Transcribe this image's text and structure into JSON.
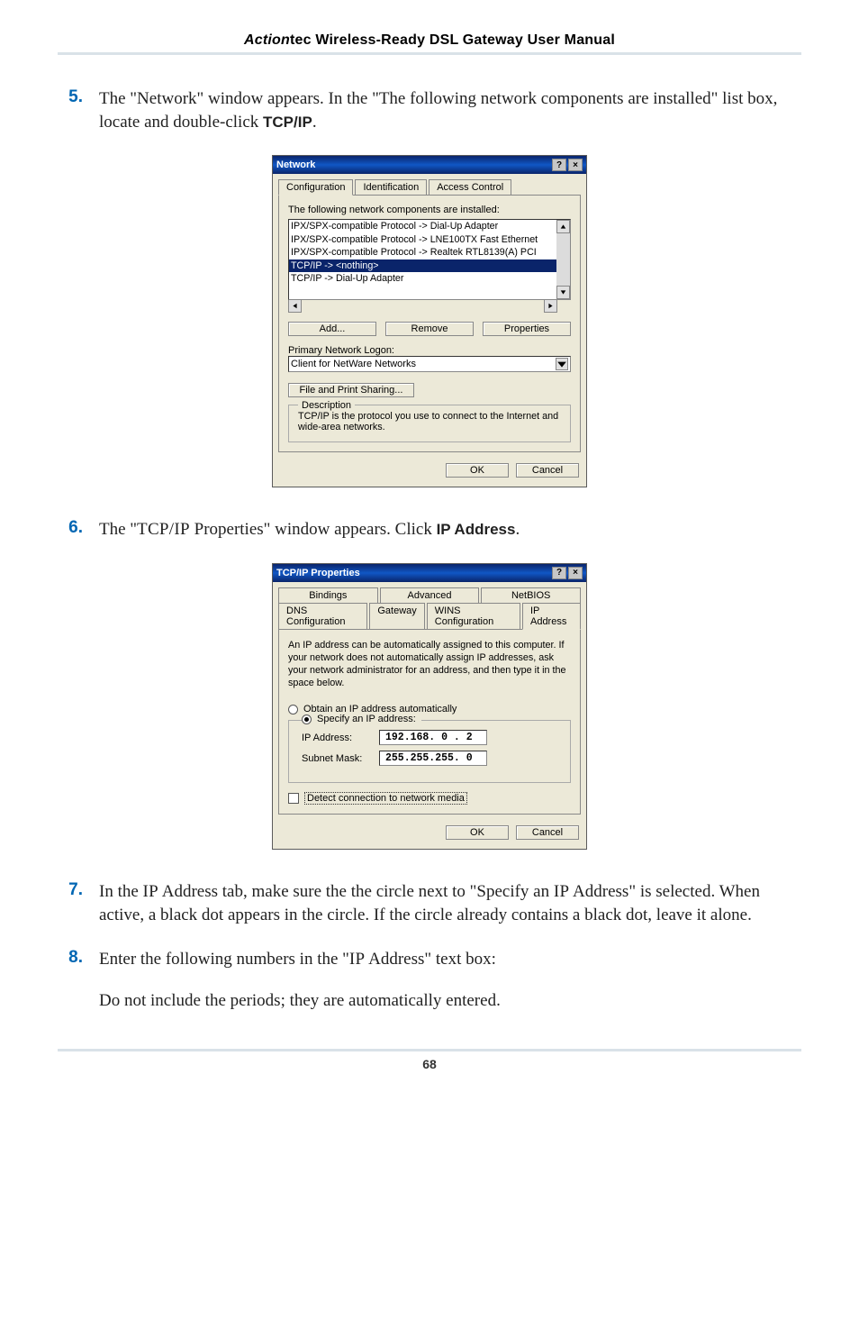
{
  "header": {
    "brand_italic": "Action",
    "brand_rest": "tec",
    "title_rest": " Wireless-Ready DSL Gateway User Manual"
  },
  "steps": {
    "s5": {
      "num": "5.",
      "text_a": "The \"Network\" window appears. In the \"The following network components are installed\" list box, locate and double-click ",
      "bold": "TCP/IP",
      "text_b": "."
    },
    "s6": {
      "num": "6.",
      "text_a": "The \"",
      "sc1": "TCP/IP",
      "text_b": " Properties\" window appears. Click ",
      "bold": "IP Address",
      "text_c": "."
    },
    "s7": {
      "num": "7.",
      "text_a": "In the ",
      "sc1": "IP",
      "text_b": " Address tab, make sure the the circle next to \"Specify an ",
      "sc2": "IP",
      "text_c": " Address\" is selected. When active, a black dot appears in the circle. If the circle already contains a black dot, leave it alone."
    },
    "s8": {
      "num": "8.",
      "text_a": "Enter the following numbers in the \"",
      "sc1": "IP",
      "text_b": " Address\" text box:",
      "para2": "Do not include the periods; they are automatically entered."
    }
  },
  "dlg1": {
    "title": "Network",
    "help_btn": "?",
    "close_btn": "×",
    "tabs": [
      "Configuration",
      "Identification",
      "Access Control"
    ],
    "list_label": "The following network components are installed:",
    "rows": [
      "IPX/SPX-compatible Protocol -> Dial-Up Adapter",
      "IPX/SPX-compatible Protocol -> LNE100TX Fast Ethernet",
      "IPX/SPX-compatible Protocol -> Realtek RTL8139(A) PCI",
      "TCP/IP -> <nothing>",
      "TCP/IP -> Dial-Up Adapter"
    ],
    "add": "Add...",
    "remove": "Remove",
    "properties": "Properties",
    "logon_label": "Primary Network Logon:",
    "logon_value": "Client for NetWare Networks",
    "fps": "File and Print Sharing...",
    "desc_title": "Description",
    "desc_body": "TCP/IP is the protocol you use to connect to the Internet and wide-area networks.",
    "ok": "OK",
    "cancel": "Cancel"
  },
  "dlg2": {
    "title": "TCP/IP Properties",
    "help_btn": "?",
    "close_btn": "×",
    "tabs_row1": [
      "Bindings",
      "Advanced",
      "NetBIOS"
    ],
    "tabs_row2": [
      "DNS Configuration",
      "Gateway",
      "WINS Configuration",
      "IP Address"
    ],
    "intro": "An IP address can be automatically assigned to this computer. If your network does not automatically assign IP addresses, ask your network administrator for an address, and then type it in the space below.",
    "r_obtain": "Obtain an IP address automatically",
    "r_specify": "Specify an IP address:",
    "ip_label": "IP Address:",
    "ip_value": "192.168. 0 . 2",
    "sm_label": "Subnet Mask:",
    "sm_value": "255.255.255. 0",
    "detect": "Detect connection to network media",
    "ok": "OK",
    "cancel": "Cancel"
  },
  "page_number": "68"
}
